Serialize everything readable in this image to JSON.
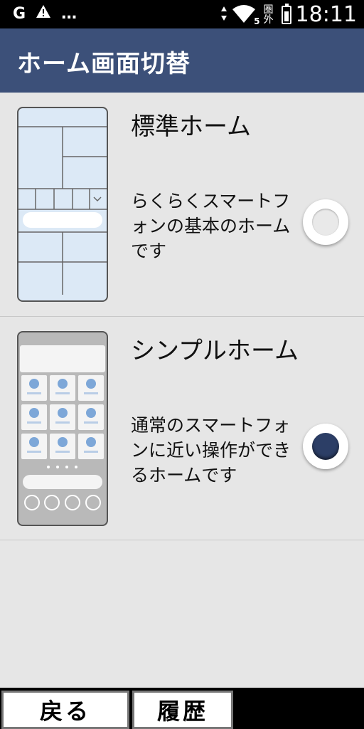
{
  "status_bar": {
    "carrier_icon_text": "G",
    "alert_icon": "warning-icon",
    "more_icon": "…",
    "network_label": "5",
    "kanji_indicator": "圏外",
    "time": "18:11"
  },
  "header": {
    "title": "ホーム画面切替"
  },
  "options": [
    {
      "title": "標準ホーム",
      "description": "らくらくスマートフォンの基本のホームです",
      "selected": false
    },
    {
      "title": "シンプルホーム",
      "description": "通常のスマートフォンに近い操作ができるホームです",
      "selected": true
    }
  ],
  "footer": {
    "back_label": "戻る",
    "history_label": "履歴"
  },
  "colors": {
    "header_bg": "#3c5079",
    "selected_radio": "#2c3e66"
  }
}
